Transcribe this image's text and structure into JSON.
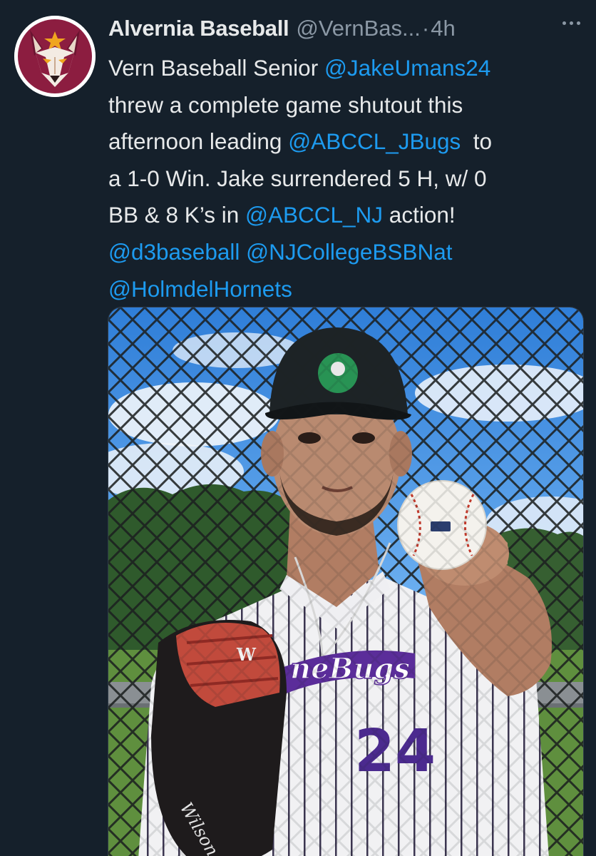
{
  "tweet": {
    "display_name": "Alvernia Baseball",
    "handle": "@VernBas...",
    "separator": "·",
    "time": "4h",
    "body": {
      "line1_text": "Vern Baseball Senior ",
      "line1_mention": "@JakeUmans24",
      "line2_text": "threw a complete game shutout this",
      "line3_text": "afternoon leading ",
      "line3_mention": "@ABCCL_JBugs",
      "line3_tail": "  to",
      "line4_text": "a 1-0 Win. Jake surrendered 5 H, w/ 0",
      "line5_text": "BB & 8 K’s in ",
      "line5_mention": "@ABCCL_NJ",
      "line5_tail": " action!",
      "line6_mention_a": "@d3baseball",
      "line6_mention_b": "@NJCollegeBSBNat",
      "line7_mention": "@HolmdelHornets"
    },
    "photo": {
      "glove_brand": "W",
      "glove_brand_script": "Wilson",
      "jersey_text": "neBugs",
      "jersey_number": "24"
    }
  },
  "colors": {
    "background": "#15202b",
    "text_primary": "#e7e9ea",
    "text_secondary": "#8b98a5",
    "link": "#1d9bf0",
    "avatar_maroon": "#8c1d40"
  },
  "icons": {
    "avatar": "wolf-logo-icon",
    "more": "more-horizontal-icon"
  }
}
